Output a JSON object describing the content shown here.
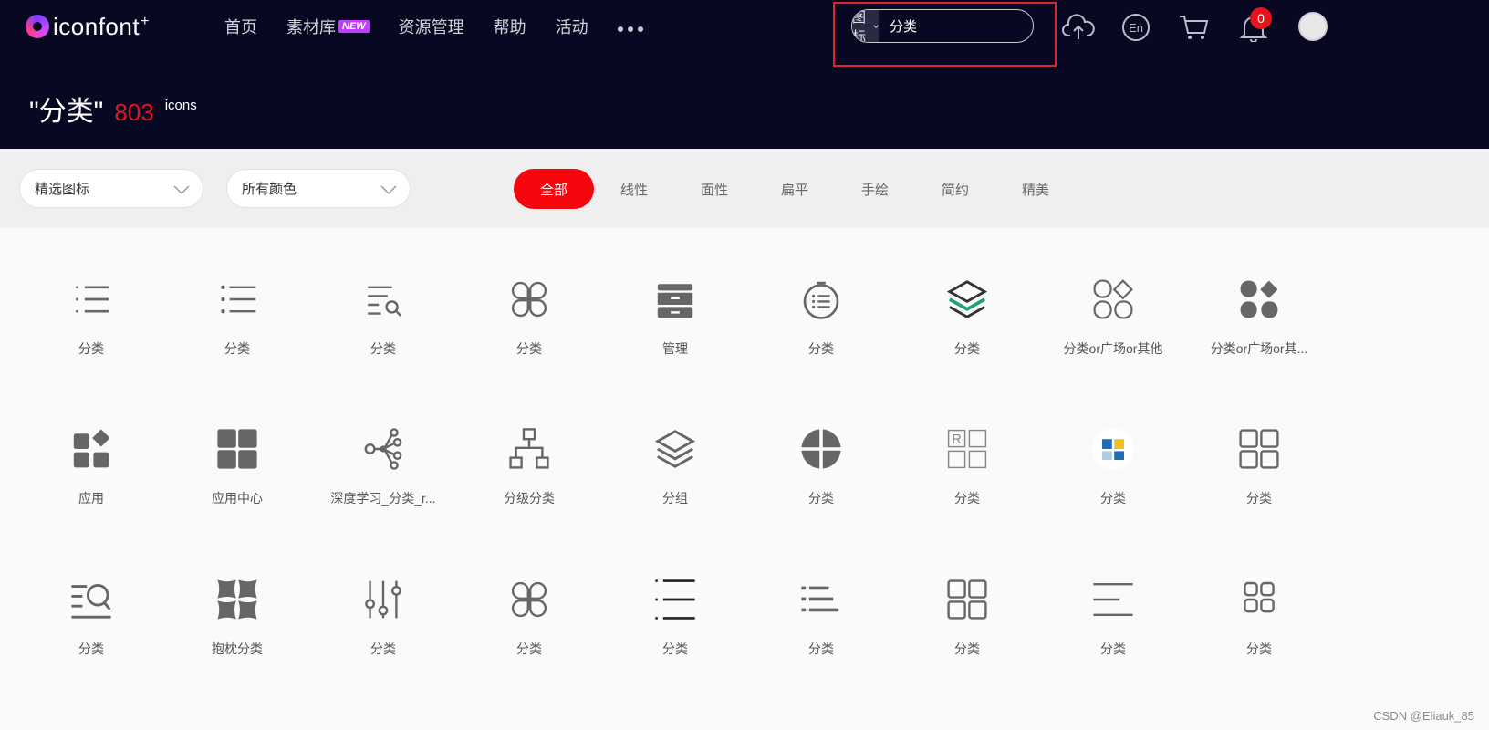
{
  "logo": {
    "name": "iconfont",
    "plus": "+"
  },
  "nav": {
    "items": [
      "首页",
      "素材库",
      "资源管理",
      "帮助",
      "活动"
    ],
    "new_badge": "NEW"
  },
  "search": {
    "type_label": "图标",
    "value": "分类"
  },
  "notifications": {
    "count": "0"
  },
  "result": {
    "query": "\"分类\"",
    "count": "803",
    "unit": "icons"
  },
  "filters": {
    "select1": "精选图标",
    "select2": "所有颜色",
    "tabs": [
      "全部",
      "线性",
      "面性",
      "扁平",
      "手绘",
      "简约",
      "精美"
    ]
  },
  "icons": [
    {
      "label": "分类",
      "icon": "list-icon"
    },
    {
      "label": "分类",
      "icon": "list-dots-icon"
    },
    {
      "label": "分类",
      "icon": "list-search-icon"
    },
    {
      "label": "分类",
      "icon": "four-petal-icon"
    },
    {
      "label": "管理",
      "icon": "cabinet-icon"
    },
    {
      "label": "分类",
      "icon": "circle-list-icon"
    },
    {
      "label": "分类",
      "icon": "layers-green-icon"
    },
    {
      "label": "分类or广场or其他",
      "icon": "grid-diamond-outline-icon"
    },
    {
      "label": "分类or广场or其...",
      "icon": "grid-diamond-filled-icon"
    },
    {
      "label": "应用",
      "icon": "apps-diamond-icon"
    },
    {
      "label": "应用中心",
      "icon": "grid-filled-icon"
    },
    {
      "label": "深度学习_分类_r...",
      "icon": "network-icon"
    },
    {
      "label": "分级分类",
      "icon": "hierarchy-icon"
    },
    {
      "label": "分组",
      "icon": "layers-icon"
    },
    {
      "label": "分类",
      "icon": "pie-quarters-icon"
    },
    {
      "label": "分类",
      "icon": "letter-grid-icon"
    },
    {
      "label": "分类",
      "icon": "color-blocks-icon"
    },
    {
      "label": "分类",
      "icon": "grid-outline-icon"
    },
    {
      "label": "分类",
      "icon": "list-zoom-icon"
    },
    {
      "label": "抱枕分类",
      "icon": "pillow-grid-icon"
    },
    {
      "label": "分类",
      "icon": "sliders-icon"
    },
    {
      "label": "分类",
      "icon": "four-petal-icon"
    },
    {
      "label": "分类",
      "icon": "list-bold-icon"
    },
    {
      "label": "分类",
      "icon": "list-arrow-icon"
    },
    {
      "label": "分类",
      "icon": "grid-outline-icon"
    },
    {
      "label": "分类",
      "icon": "lines-icon"
    },
    {
      "label": "分类",
      "icon": "grid-small-icon"
    }
  ],
  "watermark": "CSDN @Eliauk_85",
  "colors": {
    "header_bg": "#090823",
    "accent": "#f5070d",
    "icon_gray": "#666666"
  }
}
